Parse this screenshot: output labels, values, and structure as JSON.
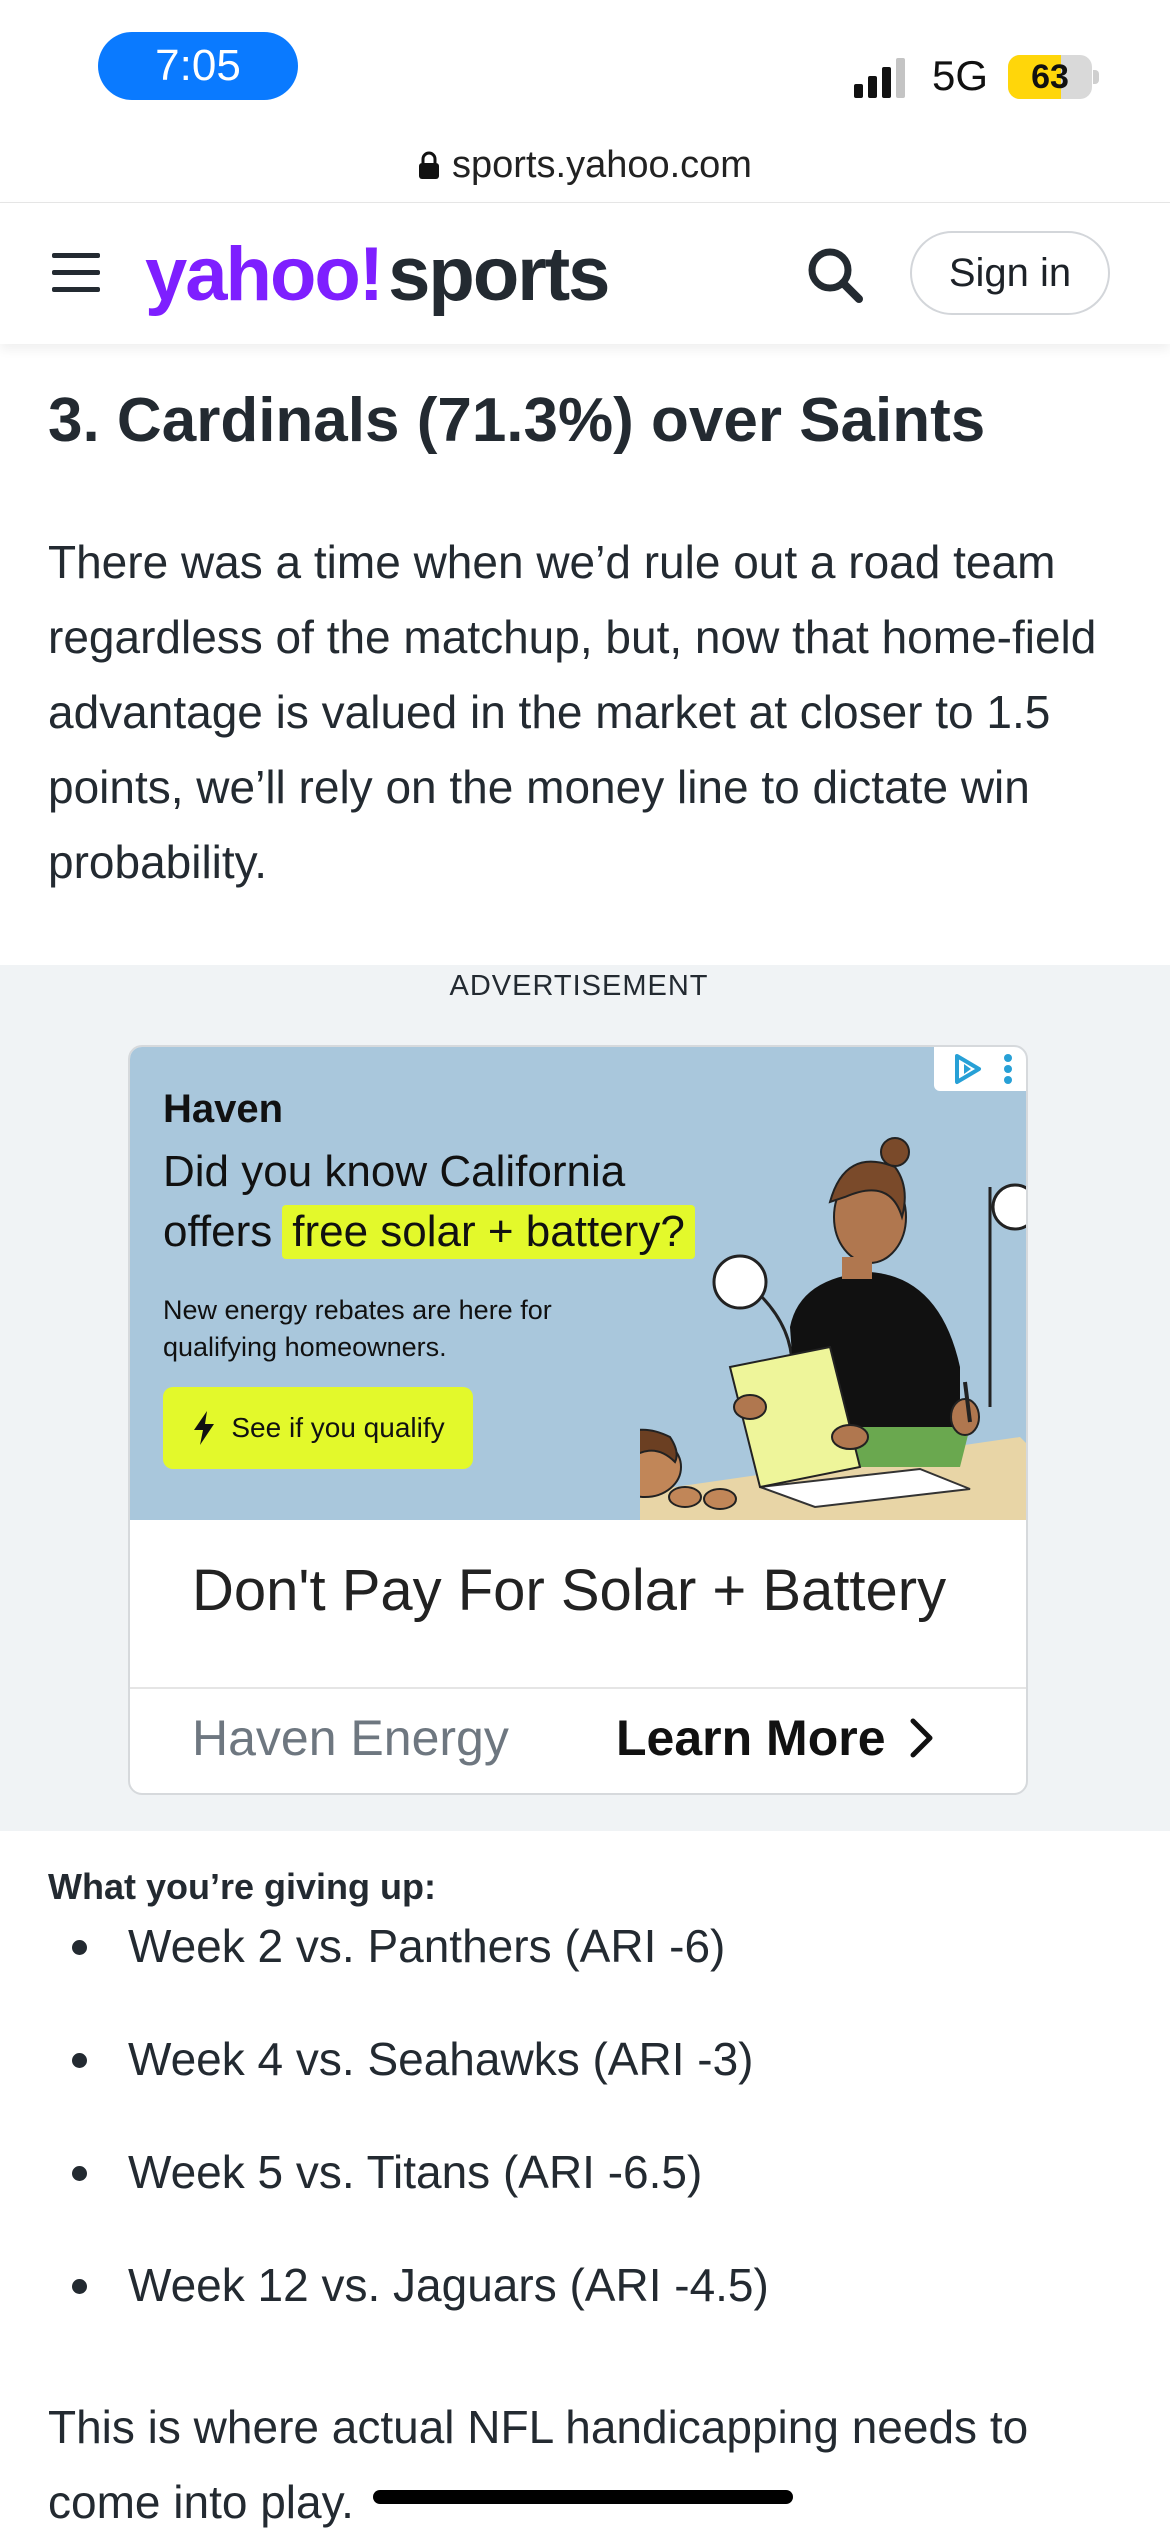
{
  "status_bar": {
    "time": "7:05",
    "network": "5G",
    "battery": "63",
    "battery_level": 0.63
  },
  "browser": {
    "url": "sports.yahoo.com"
  },
  "header": {
    "logo_yahoo": "yahoo!",
    "logo_sports": "sports",
    "signin_label": "Sign in"
  },
  "article": {
    "headline": "3. Cardinals (71.3%) over Saints",
    "paragraph": "There was a time when we’d rule out a road team regardless of the matchup, but, now that home-field advantage is valued in the market at closer to 1.5 points, we’ll rely on the money line to dictate win probability.",
    "giving_up_label": "What you’re giving up:",
    "giving_up_items": [
      "Week 2 vs. Panthers (ARI -6)",
      "Week 4 vs. Seahawks (ARI -3)",
      "Week 5 vs. Titans (ARI -6.5)",
      "Week 12 vs. Jaguars (ARI -4.5)"
    ],
    "closing": "This is where actual NFL handicapping needs to come into play."
  },
  "ad": {
    "label": "ADVERTISEMENT",
    "brand": "Haven",
    "line1": "Did you know California",
    "line2_prefix": "offers",
    "line2_highlight": "free solar + battery?",
    "small_text": "New energy rebates are here for qualifying homeowners.",
    "cta": "See if you qualify",
    "title": "Don't Pay For Solar + Battery",
    "advertiser": "Haven Energy",
    "learn_more": "Learn More",
    "colors": {
      "image_bg": "#a9c7dc",
      "highlight": "#e3f92b"
    }
  }
}
